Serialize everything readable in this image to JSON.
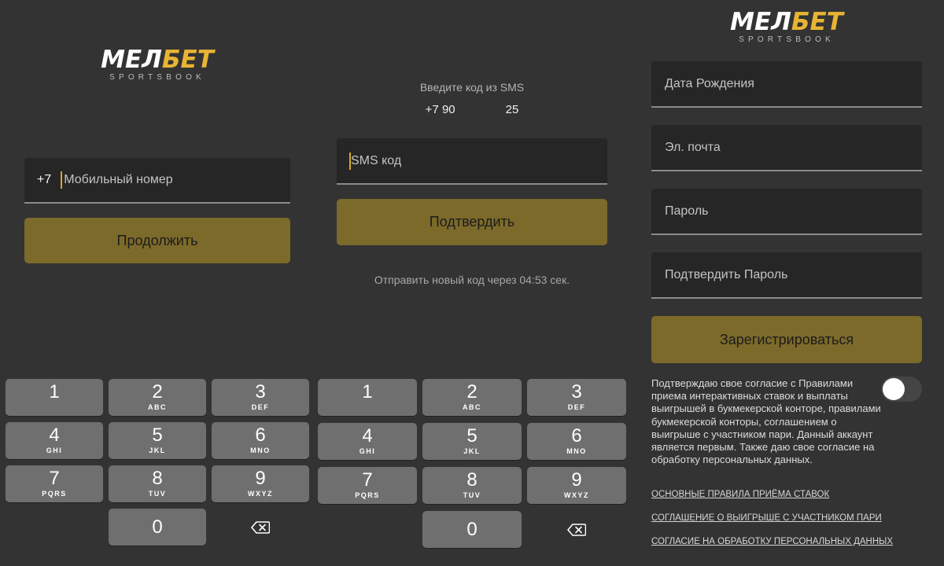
{
  "brand": {
    "name_white": "МЕЛ",
    "name_yellow": "БЕТ",
    "subtitle": "SPORTSBOOK",
    "accent_color": "#e9b434",
    "button_color": "#7c6a2a"
  },
  "phone_screen": {
    "country_code": "+7",
    "phone_placeholder": "Мобильный номер",
    "continue_button": "Продолжить"
  },
  "sms_screen": {
    "prompt": "Введите код из SMS",
    "phone_start": "+7 90",
    "phone_end": "25",
    "code_placeholder": "SMS код",
    "confirm_button": "Подтвердить",
    "resend_text": "Отправить новый код через 04:53 сек."
  },
  "keypad": {
    "keys": [
      {
        "num": "1",
        "letters": ""
      },
      {
        "num": "2",
        "letters": "ABC"
      },
      {
        "num": "3",
        "letters": "DEF"
      },
      {
        "num": "4",
        "letters": "GHI"
      },
      {
        "num": "5",
        "letters": "JKL"
      },
      {
        "num": "6",
        "letters": "MNO"
      },
      {
        "num": "7",
        "letters": "PQRS"
      },
      {
        "num": "8",
        "letters": "TUV"
      },
      {
        "num": "9",
        "letters": "WXYZ"
      },
      {
        "num": "0",
        "letters": ""
      }
    ],
    "backspace_icon": "backspace-icon"
  },
  "register_screen": {
    "birth_date_placeholder": "Дата Рождения",
    "email_placeholder": "Эл. почта",
    "password_placeholder": "Пароль",
    "confirm_password_placeholder": "Подтвердить Пароль",
    "register_button": "Зарегистрироваться",
    "consent_text": "Подтверждаю свое согласие с Правилами приема интерактивных ставок и выплаты выигрышей в букмекерской конторе, правилами букмекерской конторы, соглашением о выигрыше с участником пари. Данный аккаунт является первым. Также даю свое согласие на обработку персональных данных.",
    "consent_toggle": "off",
    "links": [
      "ОСНОВНЫЕ ПРАВИЛА ПРИЁМА СТАВОК",
      "СОГЛАШЕНИЕ О ВЫИГРЫШЕ С УЧАСТНИКОМ ПАРИ",
      "СОГЛАСИЕ НА ОБРАБОТКУ ПЕРСОНАЛЬНЫХ ДАННЫХ"
    ]
  }
}
